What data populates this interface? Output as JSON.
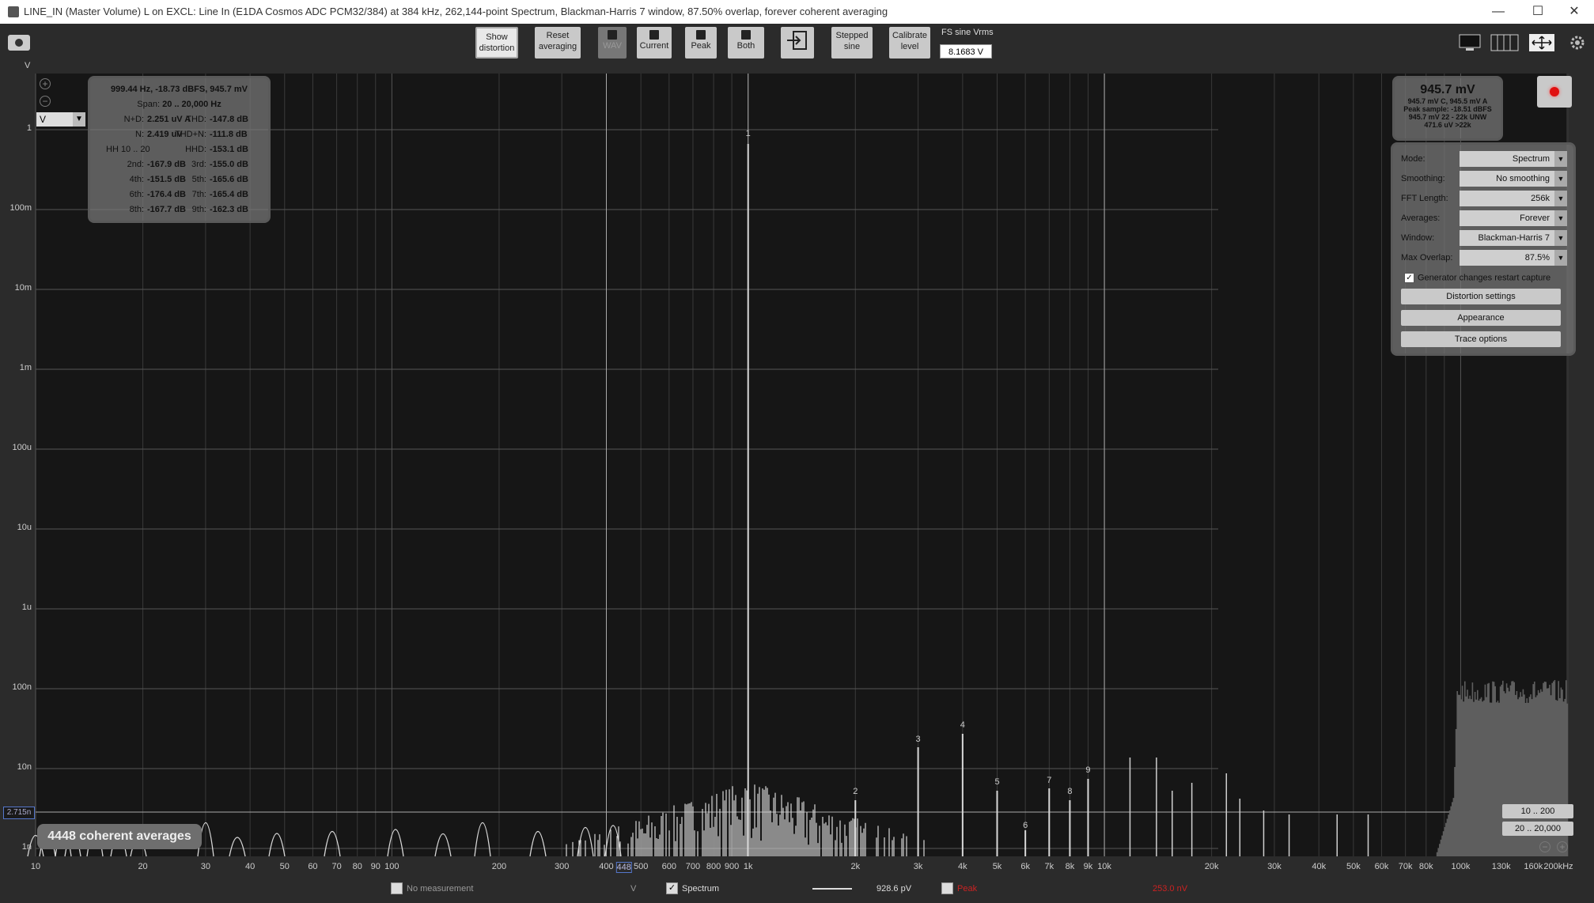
{
  "window": {
    "title": "LINE_IN (Master Volume) L on EXCL: Line In (E1DA Cosmos ADC PCM32/384) at 384 kHz, 262,144-point Spectrum, Blackman-Harris 7 window, 87.50% overlap, forever coherent averaging",
    "minimize": "—",
    "maximize": "☐",
    "close": "✕"
  },
  "toolbar": {
    "show_distortion": "Show distortion",
    "reset_averaging": "Reset averaging",
    "wav": "WAV",
    "current": "Current",
    "peak": "Peak",
    "both": "Both",
    "stepped_sine": "Stepped sine",
    "calibrate_level": "Calibrate level",
    "fs_label": "FS sine Vrms",
    "fs_value": "8.1683 V"
  },
  "axis": {
    "unit": "V",
    "unit_select": "V",
    "y_ticks": [
      "1",
      "100m",
      "10m",
      "1m",
      "100u",
      "10u",
      "1u",
      "100n",
      "10n",
      "1n"
    ],
    "x_ticks": [
      "10",
      "20",
      "30",
      "40",
      "50",
      "60",
      "70",
      "80",
      "90",
      "100",
      "200",
      "300",
      "400",
      "448",
      "500",
      "600",
      "700",
      "800",
      "900",
      "1k",
      "2k",
      "3k",
      "4k",
      "5k",
      "6k",
      "7k",
      "8k",
      "9k",
      "10k",
      "20k",
      "30k",
      "40k",
      "50k",
      "60k",
      "70k",
      "80k",
      "100k",
      "130k",
      "160k",
      "200kHz"
    ],
    "ref_level": "2.715n"
  },
  "distortion_panel": {
    "header": "999.44 Hz, -18.73 dBFS, 945.7 mV",
    "span_label": "Span:",
    "span_value": "20 .. 20,000 Hz",
    "rows": [
      {
        "l_label": "N+D:",
        "l_value": "2.251 uV A",
        "r_label": "THD:",
        "r_value": "-147.8 dB"
      },
      {
        "l_label": "N:",
        "l_value": "2.419 uV",
        "r_label": "THD+N:",
        "r_value": "-111.8 dB"
      },
      {
        "l_label": "HH 10 .. 20",
        "l_value": "",
        "r_label": "HHD:",
        "r_value": "-153.1 dB"
      },
      {
        "l_label": "2nd:",
        "l_value": "-167.9 dB",
        "r_label": "3rd:",
        "r_value": "-155.0 dB"
      },
      {
        "l_label": "4th:",
        "l_value": "-151.5 dB",
        "r_label": "5th:",
        "r_value": "-165.6 dB"
      },
      {
        "l_label": "6th:",
        "l_value": "-176.4 dB",
        "r_label": "7th:",
        "r_value": "-165.4 dB"
      },
      {
        "l_label": "8th:",
        "l_value": "-167.7 dB",
        "r_label": "9th:",
        "r_value": "-162.3 dB"
      }
    ]
  },
  "averages": "4448 coherent averages",
  "level_panel": {
    "big": "945.7 mV",
    "l1": "945.7 mV C, 945.5 mV A",
    "l2": "Peak sample: -18.51 dBFS",
    "l3": "945.7 mV 22 - 22k UNW",
    "l4": "471.6 uV >22k"
  },
  "settings": {
    "rows": [
      {
        "label": "Mode:",
        "value": "Spectrum"
      },
      {
        "label": "Smoothing:",
        "value": "No  smoothing"
      },
      {
        "label": "FFT Length:",
        "value": "256k"
      },
      {
        "label": "Averages:",
        "value": "Forever"
      },
      {
        "label": "Window:",
        "value": "Blackman-Harris 7"
      },
      {
        "label": "Max Overlap:",
        "value": "87.5%"
      }
    ],
    "checkbox": "Generator changes restart capture",
    "distortion_settings": "Distortion settings",
    "appearance": "Appearance",
    "trace_options": "Trace options"
  },
  "range_buttons": {
    "low": "10 .. 200",
    "high": "20 .. 20,000"
  },
  "harmonic_labels": [
    "1",
    "2",
    "3",
    "4",
    "5",
    "6",
    "7",
    "8",
    "9"
  ],
  "statusbar": {
    "no_measurement": "No measurement",
    "v": "V",
    "spectrum": "Spectrum",
    "spectrum_value": "928.6 pV",
    "peak": "Peak",
    "peak_value": "253.0 nV"
  },
  "colors": {
    "trace": "#d8d8d8",
    "grid": "#444444",
    "record": "#e01010",
    "peak": "#cc2222"
  }
}
